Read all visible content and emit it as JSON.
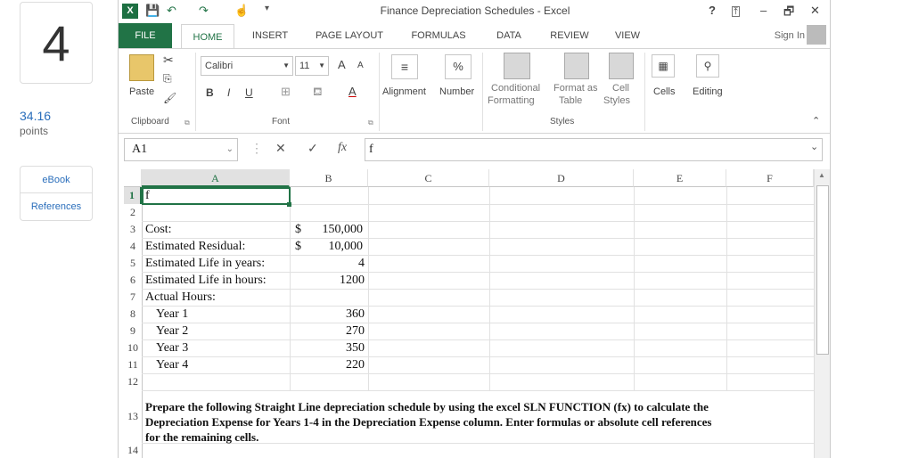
{
  "left": {
    "question_number": "4",
    "points": "34.16",
    "points_label": "points",
    "ebook": "eBook",
    "references": "References"
  },
  "title": {
    "window_title": "Finance Depreciation Schedules - Excel",
    "help": "?",
    "minimize": "–",
    "restore": "🗗",
    "close": "✕"
  },
  "tabs": {
    "file": "FILE",
    "home": "HOME",
    "insert": "INSERT",
    "page_layout": "PAGE LAYOUT",
    "formulas": "FORMULAS",
    "data": "DATA",
    "review": "REVIEW",
    "view": "VIEW",
    "sign_in": "Sign In"
  },
  "ribbon": {
    "paste": "Paste",
    "clipboard": "Clipboard",
    "font_name": "Calibri",
    "font_size": "11",
    "font": "Font",
    "bold": "B",
    "italic": "I",
    "underline": "U",
    "alignment": "Alignment",
    "number": "Number",
    "percent": "%",
    "conditional1": "Conditional",
    "conditional2": "Formatting",
    "format_as1": "Format as",
    "format_as2": "Table",
    "cell_styles1": "Cell",
    "cell_styles2": "Styles",
    "styles": "Styles",
    "cells": "Cells",
    "editing": "Editing",
    "grow": "A",
    "shrink": "A",
    "font_color": "A"
  },
  "formula_bar": {
    "name_box": "A1",
    "cancel": "✕",
    "enter": "✓",
    "fx": "fx",
    "content": "f"
  },
  "columns": [
    "A",
    "B",
    "C",
    "D",
    "E",
    "F"
  ],
  "rows": [
    "1",
    "2",
    "3",
    "4",
    "5",
    "6",
    "7",
    "8",
    "9",
    "10",
    "11",
    "12",
    "13",
    "14"
  ],
  "cells": {
    "a1": "f",
    "a3": "Cost:",
    "b3_cur": "$",
    "b3": "150,000",
    "a4": "Estimated Residual:",
    "b4_cur": "$",
    "b4": "10,000",
    "a5": "Estimated Life in years:",
    "b5": "4",
    "a6": "Estimated Life in hours:",
    "b6": "1200",
    "a7": "Actual Hours:",
    "a8": "Year 1",
    "b8": "360",
    "a9": "Year 2",
    "b9": "270",
    "a10": "Year 3",
    "b10": "350",
    "a11": "Year 4",
    "b11": "220",
    "a13_l1": "Prepare the following Straight Line depreciation schedule by using the excel SLN FUNCTION (fx) to calculate the",
    "a13_l2": "Depreciation Expense for Years 1-4 in the Depreciation Expense column. Enter formulas or absolute cell references",
    "a13_l3": "for the remaining cells."
  }
}
